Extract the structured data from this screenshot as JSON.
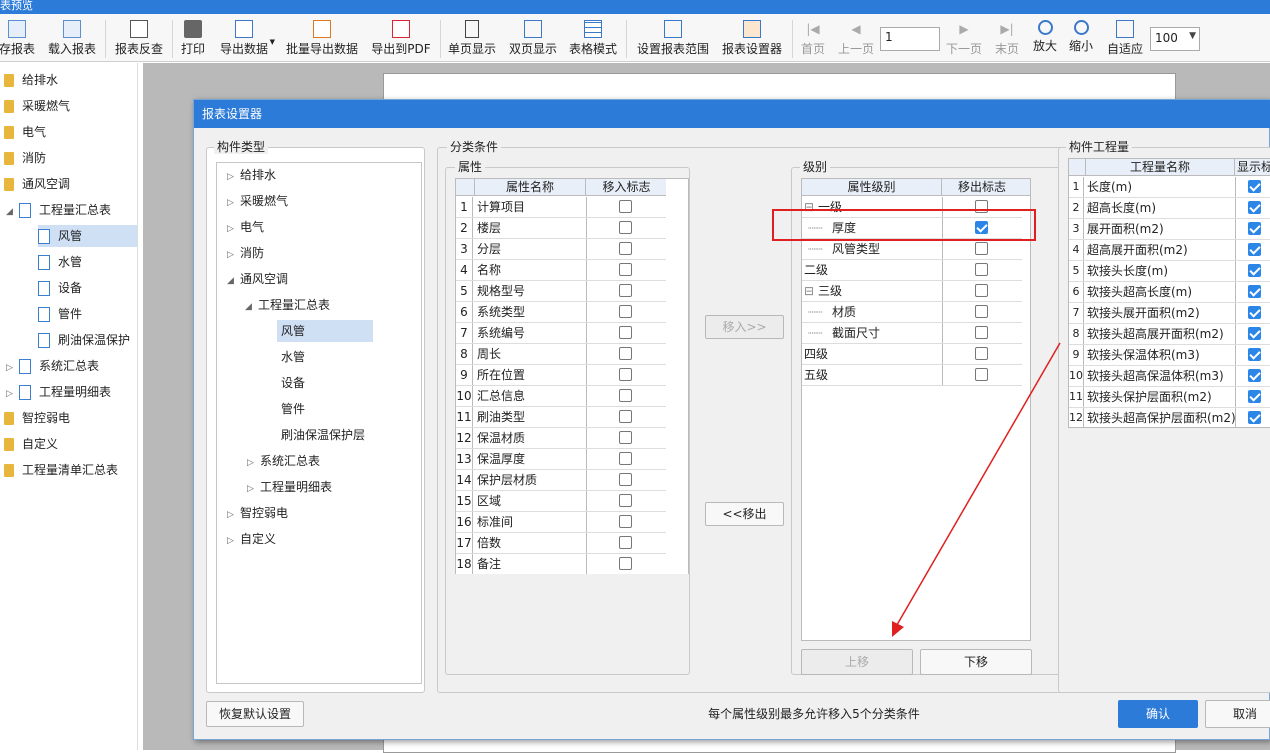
{
  "window": {
    "title": "表预览"
  },
  "toolbar": {
    "items": [
      "存报表",
      "载入报表",
      "报表反查",
      "打印",
      "导出数据",
      "批量导出数据",
      "导出到PDF",
      "单页显示",
      "双页显示",
      "表格模式",
      "设置报表范围",
      "报表设置器",
      "首页",
      "上一页",
      "下一页",
      "末页",
      "放大",
      "缩小",
      "自适应"
    ],
    "page_value": "1",
    "zoom_value": "100"
  },
  "left_tree": {
    "items": [
      "给排水",
      "采暖燃气",
      "电气",
      "消防",
      "通风空调",
      "工程量汇总表",
      "风管",
      "水管",
      "设备",
      "管件",
      "刷油保温保护",
      "系统汇总表",
      "工程量明细表",
      "智控弱电",
      "自定义",
      "工程量清单汇总表"
    ]
  },
  "dialog": {
    "title": "报表设置器",
    "component_types": {
      "label": "构件类型",
      "items": [
        "给排水",
        "采暖燃气",
        "电气",
        "消防",
        "通风空调",
        "工程量汇总表",
        "风管",
        "水管",
        "设备",
        "管件",
        "刷油保温保护层",
        "系统汇总表",
        "工程量明细表",
        "智控弱电",
        "自定义"
      ]
    },
    "classification": {
      "label": "分类条件",
      "attributes": {
        "label": "属性",
        "col_name": "属性名称",
        "col_flag": "移入标志",
        "rows": [
          {
            "n": "1",
            "name": "计算项目"
          },
          {
            "n": "2",
            "name": "楼层"
          },
          {
            "n": "3",
            "name": "分层"
          },
          {
            "n": "4",
            "name": "名称"
          },
          {
            "n": "5",
            "name": "规格型号"
          },
          {
            "n": "6",
            "name": "系统类型"
          },
          {
            "n": "7",
            "name": "系统编号"
          },
          {
            "n": "8",
            "name": "周长"
          },
          {
            "n": "9",
            "name": "所在位置"
          },
          {
            "n": "10",
            "name": "汇总信息"
          },
          {
            "n": "11",
            "name": "刷油类型"
          },
          {
            "n": "12",
            "name": "保温材质"
          },
          {
            "n": "13",
            "name": "保温厚度"
          },
          {
            "n": "14",
            "name": "保护层材质"
          },
          {
            "n": "15",
            "name": "区域"
          },
          {
            "n": "16",
            "name": "标准间"
          },
          {
            "n": "17",
            "name": "倍数"
          },
          {
            "n": "18",
            "name": "备注"
          }
        ]
      },
      "move_in": "移入>>",
      "move_out": "<<移出",
      "levels": {
        "label": "级别",
        "col_level": "属性级别",
        "col_flag": "移出标志",
        "rows": [
          {
            "name": "一级",
            "checked": false
          },
          {
            "name": "厚度",
            "checked": true
          },
          {
            "name": "风管类型",
            "checked": false
          },
          {
            "name": "二级",
            "checked": false
          },
          {
            "name": "三级",
            "checked": false
          },
          {
            "name": "材质",
            "checked": false
          },
          {
            "name": "截面尺寸",
            "checked": false
          },
          {
            "name": "四级",
            "checked": false
          },
          {
            "name": "五级",
            "checked": false
          }
        ]
      },
      "move_up": "上移",
      "move_down": "下移"
    },
    "quantities": {
      "label": "构件工程量",
      "col_name": "工程量名称",
      "col_show": "显示标",
      "rows": [
        {
          "n": "1",
          "name": "长度(m)"
        },
        {
          "n": "2",
          "name": "超高长度(m)"
        },
        {
          "n": "3",
          "name": "展开面积(m2)"
        },
        {
          "n": "4",
          "name": "超高展开面积(m2)"
        },
        {
          "n": "5",
          "name": "软接头长度(m)"
        },
        {
          "n": "6",
          "name": "软接头超高长度(m)"
        },
        {
          "n": "7",
          "name": "软接头展开面积(m2)"
        },
        {
          "n": "8",
          "name": "软接头超高展开面积(m2)"
        },
        {
          "n": "9",
          "name": "软接头保温体积(m3)"
        },
        {
          "n": "10",
          "name": "软接头超高保温体积(m3)"
        },
        {
          "n": "11",
          "name": "软接头保护层面积(m2)"
        },
        {
          "n": "12",
          "name": "软接头超高保护层面积(m2)"
        }
      ]
    },
    "restore_default": "恢复默认设置",
    "hint": "每个属性级别最多允许移入5个分类条件",
    "ok": "确认",
    "cancel": "取消"
  },
  "colors": {
    "accent": "#2c7bd8",
    "highlight": "#e02020"
  }
}
